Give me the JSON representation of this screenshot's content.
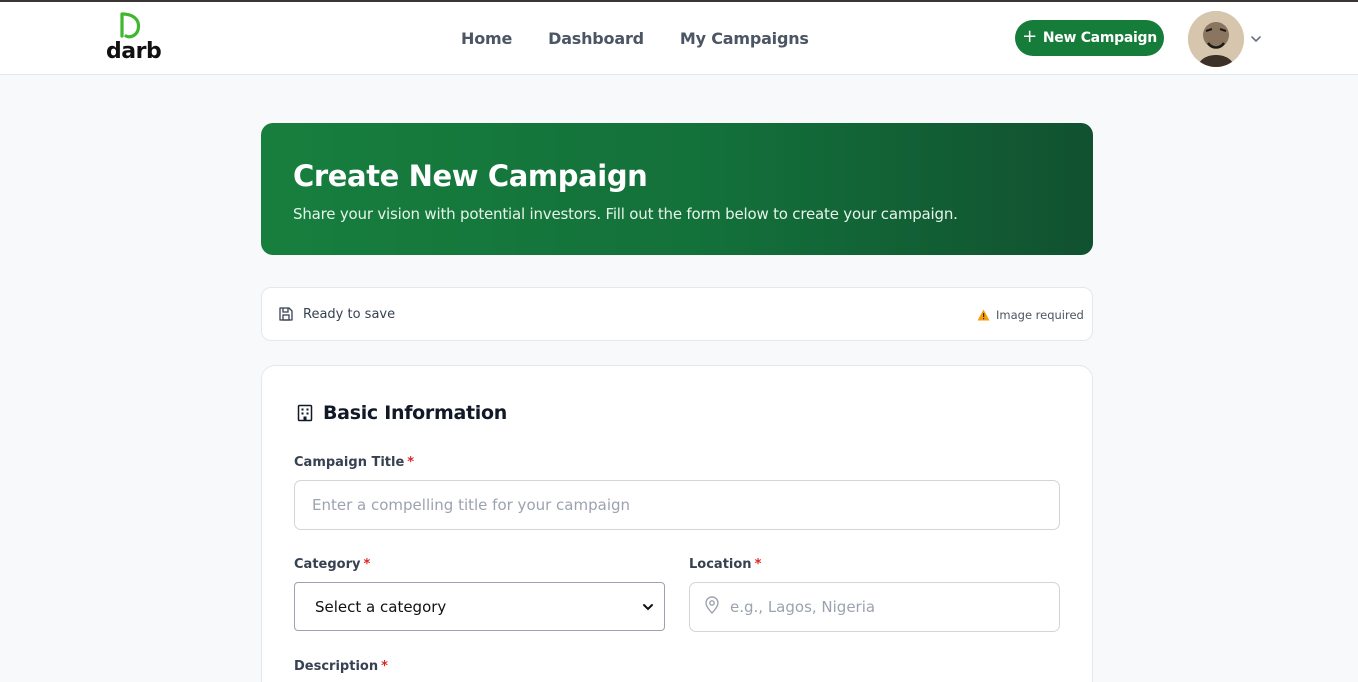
{
  "header": {
    "logo_text": "darb",
    "nav": [
      "Home",
      "Dashboard",
      "My Campaigns"
    ],
    "new_campaign_label": "New Campaign",
    "brand_color": "#167c3a"
  },
  "hero": {
    "title": "Create New Campaign",
    "subtitle": "Share your vision with potential investors. Fill out the form below to create your campaign."
  },
  "status": {
    "save_state": "Ready to save",
    "warning": "Image required"
  },
  "form": {
    "section_title": "Basic Information",
    "title_label": "Campaign Title",
    "title_placeholder": "Enter a compelling title for your campaign",
    "category_label": "Category",
    "category_value": "Select a category",
    "location_label": "Location",
    "location_placeholder": "e.g., Lagos, Nigeria",
    "description_label": "Description",
    "required_mark": "*"
  }
}
